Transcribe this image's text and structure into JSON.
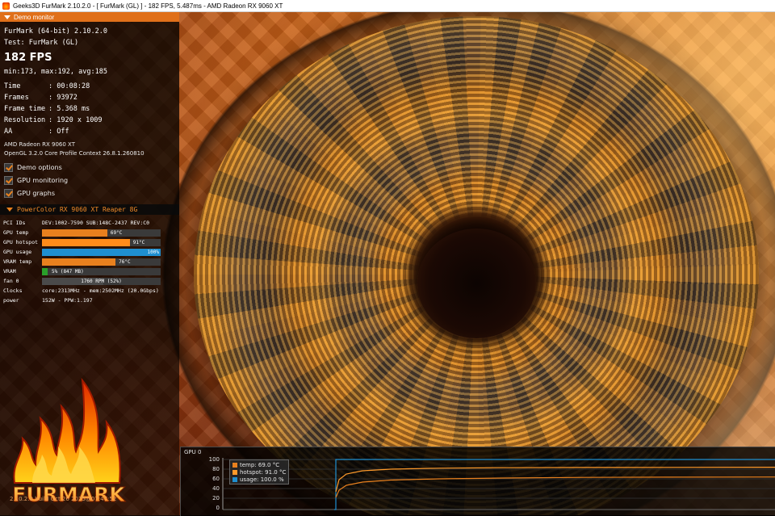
{
  "window": {
    "title": "Geeks3D FurMark 2.10.2.0 - [ FurMark (GL) ] - 182 FPS, 5.487ms - AMD Radeon RX 9060 XT"
  },
  "demo_monitor": {
    "header": "Demo monitor",
    "app_line": "FurMark (64-bit) 2.10.2.0",
    "test_line": "Test: FurMark (GL)",
    "fps": "182 FPS",
    "minmax": "min:173, max:192, avg:185",
    "stats": [
      {
        "key": "Time",
        "value": "00:08:28"
      },
      {
        "key": "Frames",
        "value": "93972"
      },
      {
        "key": "Frame time",
        "value": "5.368 ms"
      },
      {
        "key": "Resolution",
        "value": "1920 x 1009"
      },
      {
        "key": "AA",
        "value": "Off"
      }
    ],
    "gpu_name": "AMD Radeon RX 9060 XT",
    "gl_context": "OpenGL 3.2.0 Core Profile Context 26.8.1.260810",
    "options": [
      {
        "label": "Demo options",
        "checked": true
      },
      {
        "label": "GPU monitoring",
        "checked": true
      },
      {
        "label": "GPU graphs",
        "checked": true
      }
    ]
  },
  "gpu_monitor": {
    "header": "PowerColor RX 9060 XT Reaper 8G",
    "pci": {
      "key": "PCI IDs",
      "value": "DEV:1002-7590 SUB:148C-2437 REV:C0"
    },
    "bars": [
      {
        "key": "GPU temp",
        "text": "69°C",
        "fraction": 0.55,
        "color": "#e8801e"
      },
      {
        "key": "GPU hotspot",
        "text": "91°C",
        "fraction": 0.74,
        "color": "#ff8c1a"
      },
      {
        "key": "GPU usage",
        "text": "100%",
        "fraction": 1.0,
        "color": "#1f8fd0"
      },
      {
        "key": "VRAM temp",
        "text": "76°C",
        "fraction": 0.62,
        "color": "#e8801e"
      },
      {
        "key": "VRAM",
        "text": "5% (847 MB)",
        "fraction": 0.05,
        "color": "#2aa02a"
      },
      {
        "key": "fan 0",
        "text": "1760 RPM (52%)",
        "fraction": 0.52,
        "color": "#4a4a4a"
      }
    ],
    "clocks": {
      "key": "Clocks",
      "value": "core:2313MHz - mem:2502MHz (20.0Gbps)"
    },
    "power": {
      "key": "power",
      "value": "152W - PPW:1.197"
    }
  },
  "logo": {
    "text": "FURMARK"
  },
  "build": "2.10.2.0 build Oct 26 2025@07:47:52",
  "graph": {
    "title": "GPU 0",
    "yticks": [
      "100",
      "80",
      "60",
      "40",
      "20",
      "0"
    ],
    "legend": [
      {
        "label": "temp: 69.0 °C",
        "color": "#e8801e"
      },
      {
        "label": "hotspot: 91.0 °C",
        "color": "#ff9a2a"
      },
      {
        "label": "usage: 100.0 %",
        "color": "#1f8fd0"
      }
    ]
  },
  "colors": {
    "accent": "#e0701a",
    "temp": "#e8801e",
    "hotspot": "#ff9a2a",
    "usage": "#1f8fd0"
  }
}
